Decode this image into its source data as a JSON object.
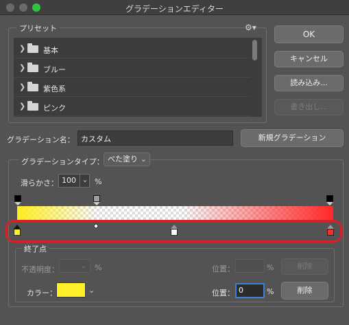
{
  "window": {
    "title": "グラデーションエディター"
  },
  "presets": {
    "label": "プリセット",
    "settings_icon": "gear-icon",
    "items": [
      {
        "label": "基本"
      },
      {
        "label": "ブルー"
      },
      {
        "label": "紫色系"
      },
      {
        "label": "ピンク"
      }
    ]
  },
  "buttons": {
    "ok": "OK",
    "cancel": "キャンセル",
    "load": "読み込み...",
    "save": "書き出し...",
    "new_gradient": "新規グラデーション"
  },
  "name": {
    "label": "グラデーション名：",
    "value": "カスタム"
  },
  "gradient_type": {
    "label": "グラデーションタイプ：",
    "value": "べた塗り"
  },
  "smoothness": {
    "label": "滑らかさ：",
    "value": "100",
    "unit": "%"
  },
  "gradient": {
    "opacity_stops": [
      {
        "location": 0,
        "color": "#000000"
      },
      {
        "location": 25,
        "color": "#9e9e9e"
      },
      {
        "location": 100,
        "color": "#000000"
      }
    ],
    "color_stops": [
      {
        "location": 0,
        "color": "#fff02a"
      },
      {
        "location": 50,
        "color": "#ffffff"
      },
      {
        "location": 100,
        "color": "#ff2a2a"
      }
    ],
    "midpoint": 25
  },
  "stops": {
    "group_label": "終了点",
    "opacity_label": "不透明度：",
    "opacity_unit": "%",
    "opacity_location_label": "位置：",
    "opacity_location_unit": "%",
    "delete_label": "削除",
    "color_label": "カラー：",
    "color_value": "#fff02a",
    "color_location_label": "位置：",
    "color_location_value": "0",
    "color_location_unit": "%"
  }
}
